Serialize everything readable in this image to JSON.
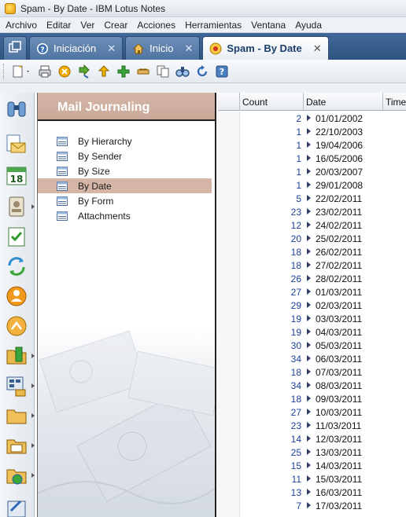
{
  "window": {
    "title": "Spam - By Date - IBM Lotus Notes"
  },
  "menu": [
    "Archivo",
    "Editar",
    "Ver",
    "Crear",
    "Acciones",
    "Herramientas",
    "Ventana",
    "Ayuda"
  ],
  "tabs": [
    {
      "label": "",
      "icon": "window-list-icon",
      "active": false
    },
    {
      "label": "Iniciación",
      "icon": "help-icon",
      "active": false
    },
    {
      "label": "Inicio",
      "icon": "home-icon",
      "active": false
    },
    {
      "label": "Spam - By Date",
      "icon": "database-icon",
      "active": true
    }
  ],
  "nav": {
    "header": "Mail Journaling",
    "items": [
      "By Hierarchy",
      "By Sender",
      "By Size",
      "By Date",
      "By Form",
      "Attachments"
    ],
    "selected": "By Date"
  },
  "view": {
    "columns": [
      "Count",
      "Date",
      "Time"
    ],
    "rows": [
      {
        "count": "2",
        "date": "01/01/2002"
      },
      {
        "count": "1",
        "date": "22/10/2003"
      },
      {
        "count": "1",
        "date": "19/04/2006"
      },
      {
        "count": "1",
        "date": "16/05/2006"
      },
      {
        "count": "1",
        "date": "20/03/2007"
      },
      {
        "count": "1",
        "date": "29/01/2008"
      },
      {
        "count": "5",
        "date": "22/02/2011"
      },
      {
        "count": "23",
        "date": "23/02/2011"
      },
      {
        "count": "12",
        "date": "24/02/2011"
      },
      {
        "count": "20",
        "date": "25/02/2011"
      },
      {
        "count": "18",
        "date": "26/02/2011"
      },
      {
        "count": "18",
        "date": "27/02/2011"
      },
      {
        "count": "26",
        "date": "28/02/2011"
      },
      {
        "count": "27",
        "date": "01/03/2011"
      },
      {
        "count": "29",
        "date": "02/03/2011"
      },
      {
        "count": "19",
        "date": "03/03/2011"
      },
      {
        "count": "19",
        "date": "04/03/2011"
      },
      {
        "count": "30",
        "date": "05/03/2011"
      },
      {
        "count": "34",
        "date": "06/03/2011"
      },
      {
        "count": "18",
        "date": "07/03/2011"
      },
      {
        "count": "34",
        "date": "08/03/2011"
      },
      {
        "count": "18",
        "date": "09/03/2011"
      },
      {
        "count": "27",
        "date": "10/03/2011"
      },
      {
        "count": "23",
        "date": "11/03/2011"
      },
      {
        "count": "14",
        "date": "12/03/2011"
      },
      {
        "count": "25",
        "date": "13/03/2011"
      },
      {
        "count": "15",
        "date": "14/03/2011"
      },
      {
        "count": "11",
        "date": "15/03/2011"
      },
      {
        "count": "13",
        "date": "16/03/2011"
      },
      {
        "count": "7",
        "date": "17/03/2011"
      }
    ]
  },
  "colors": {
    "accent_nav": "#d5b6a6",
    "tabbar": "#2f557f",
    "count_text": "#1b3f9b"
  }
}
